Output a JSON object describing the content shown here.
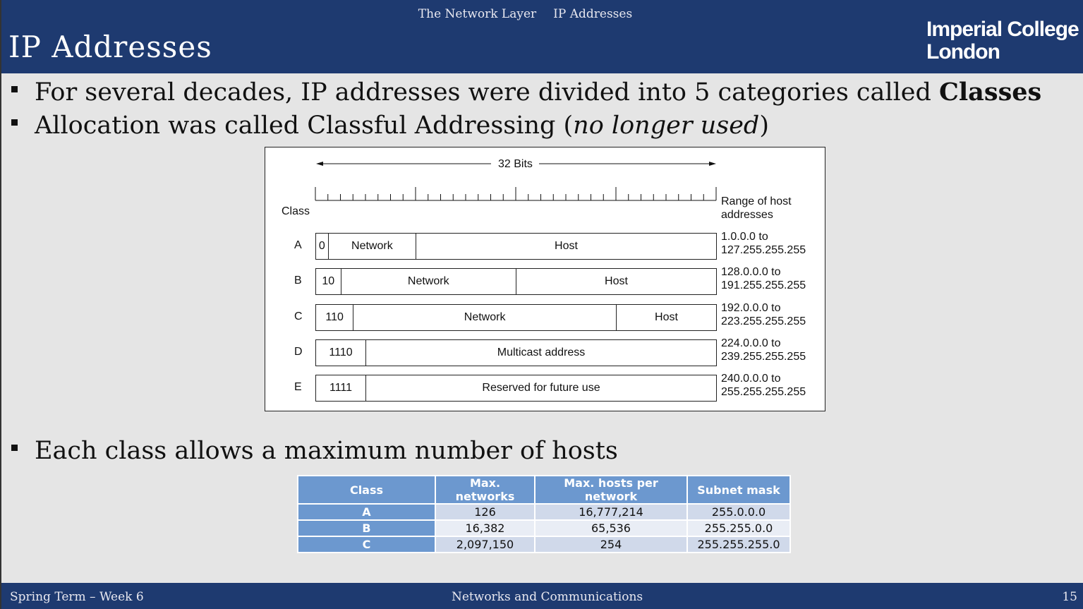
{
  "header": {
    "breadcrumb": [
      "The Network Layer",
      "IP Addresses"
    ],
    "title": "IP Addresses",
    "logo": [
      "Imperial College",
      "London"
    ]
  },
  "bullets": [
    {
      "text": "For several decades, IP addresses were divided into 5 categories called ",
      "bold": "Classes"
    },
    {
      "text": "Allocation was called Classful Addressing (",
      "italic": "no longer used",
      "after": ")"
    },
    {
      "text": "Each class allows a maximum number of hosts"
    }
  ],
  "diagram": {
    "bits_label": "32 Bits",
    "total_bits": 32,
    "class_label": "Class",
    "range_label": [
      "Range of host",
      "addresses"
    ],
    "rows": [
      {
        "cls": "A",
        "segments": [
          {
            "label": "0",
            "bits": 1
          },
          {
            "label": "Network",
            "bits": 7
          },
          {
            "label": "Host",
            "bits": 24
          }
        ],
        "range": [
          "1.0.0.0 to",
          "127.255.255.255"
        ]
      },
      {
        "cls": "B",
        "segments": [
          {
            "label": "10",
            "bits": 2
          },
          {
            "label": "Network",
            "bits": 14
          },
          {
            "label": "Host",
            "bits": 16
          }
        ],
        "range": [
          "128.0.0.0 to",
          "191.255.255.255"
        ]
      },
      {
        "cls": "C",
        "segments": [
          {
            "label": "110",
            "bits": 3
          },
          {
            "label": "Network",
            "bits": 21
          },
          {
            "label": "Host",
            "bits": 8
          }
        ],
        "range": [
          "192.0.0.0 to",
          "223.255.255.255"
        ]
      },
      {
        "cls": "D",
        "segments": [
          {
            "label": "1110",
            "bits": 4
          },
          {
            "label": "Multicast address",
            "bits": 28
          }
        ],
        "range": [
          "224.0.0.0 to",
          "239.255.255.255"
        ]
      },
      {
        "cls": "E",
        "segments": [
          {
            "label": "1111",
            "bits": 4
          },
          {
            "label": "Reserved for future use",
            "bits": 28
          }
        ],
        "range": [
          "240.0.0.0 to",
          "255.255.255.255"
        ]
      }
    ]
  },
  "table": {
    "headers": [
      "Class",
      "Max. networks",
      "Max. hosts per network",
      "Subnet mask"
    ],
    "rows": [
      [
        "A",
        "126",
        "16,777,214",
        "255.0.0.0"
      ],
      [
        "B",
        "16,382",
        "65,536",
        "255.255.0.0"
      ],
      [
        "C",
        "2,097,150",
        "254",
        "255.255.255.0"
      ]
    ]
  },
  "footer": {
    "left": "Spring Term – Week 6",
    "center": "Networks and Communications",
    "page": "15"
  }
}
